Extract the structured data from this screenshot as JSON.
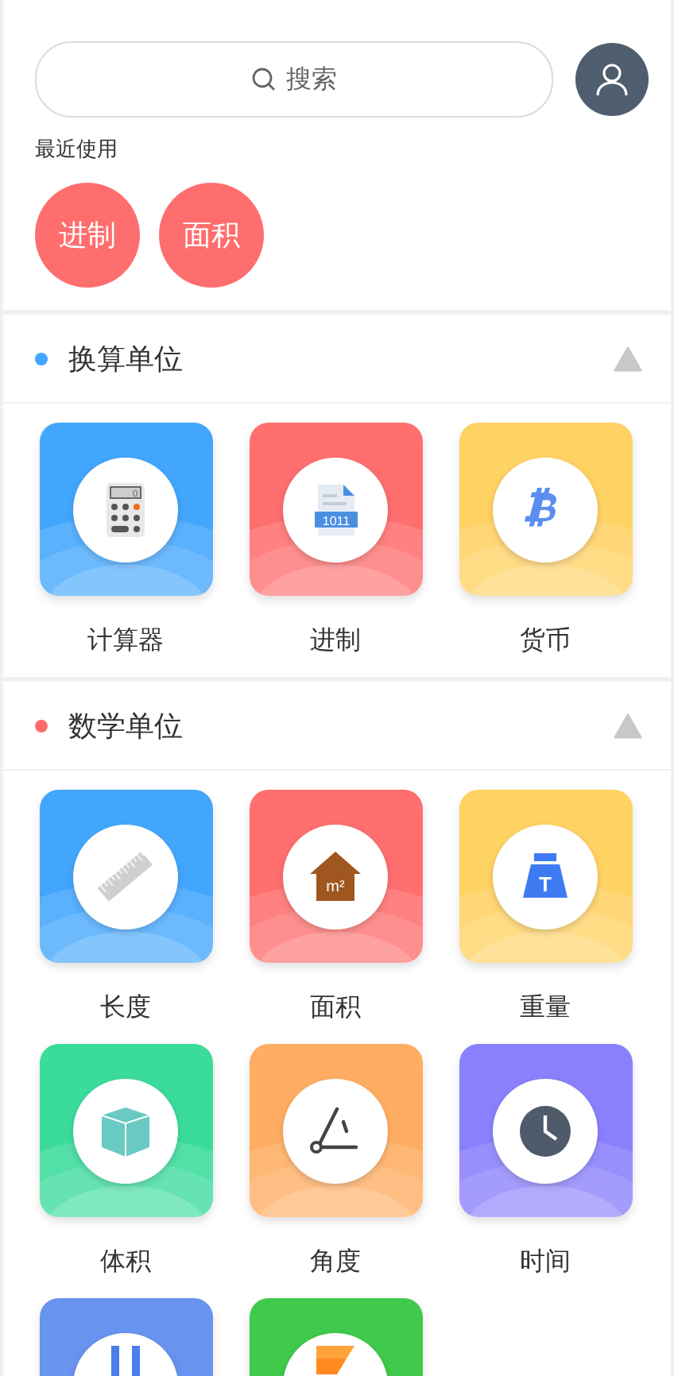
{
  "search": {
    "placeholder": "搜索"
  },
  "recent": {
    "title": "最近使用",
    "items": [
      "进制",
      "面积"
    ]
  },
  "sections": [
    {
      "title": "换算单位",
      "color": "#42a5ff",
      "expanded": true,
      "tiles": [
        {
          "label": "计算器",
          "kind": "calculator",
          "color": "#43a6fd",
          "icon_text": "0"
        },
        {
          "label": "进制",
          "kind": "binary",
          "color": "#ff6f6f",
          "icon_text": "1011"
        },
        {
          "label": "货币",
          "kind": "bitcoin",
          "color": "#ffd264"
        }
      ]
    },
    {
      "title": "数学单位",
      "color": "#ff6b6b",
      "expanded": true,
      "tiles": [
        {
          "label": "长度",
          "kind": "ruler",
          "color": "#43a6fd"
        },
        {
          "label": "面积",
          "kind": "area",
          "color": "#ff6f6f",
          "icon_text": "m²"
        },
        {
          "label": "重量",
          "kind": "weight",
          "color": "#ffd264",
          "icon_text": "T"
        },
        {
          "label": "体积",
          "kind": "cube",
          "color": "#3bdb9c"
        },
        {
          "label": "角度",
          "kind": "angle",
          "color": "#ffad62"
        },
        {
          "label": "时间",
          "kind": "clock",
          "color": "#8a80fd"
        },
        {
          "kind": "bars",
          "color": "#6893ee"
        },
        {
          "kind": "flag",
          "color": "#40c94a"
        }
      ]
    }
  ]
}
